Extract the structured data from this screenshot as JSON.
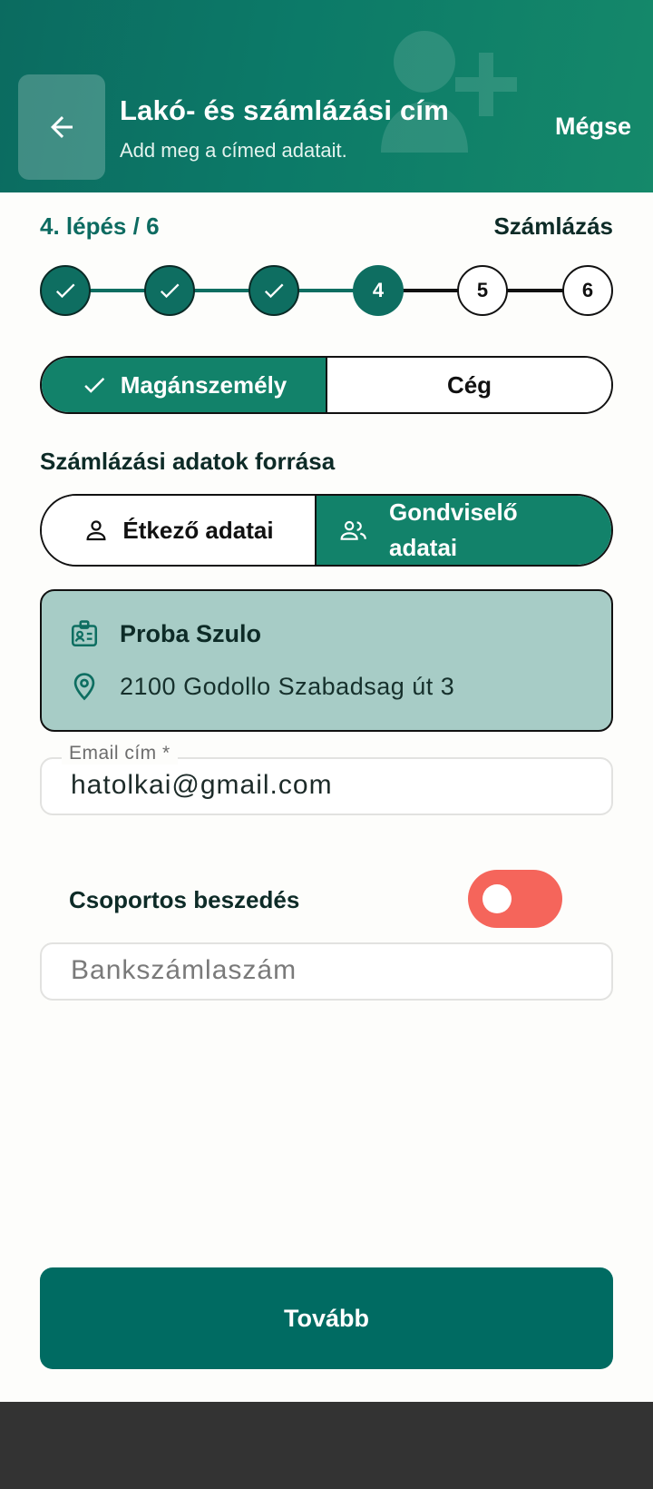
{
  "header": {
    "title": "Lakó- és számlázási cím",
    "subtitle": "Add meg a címed adatait.",
    "cancel_label": "Mégse",
    "back_icon": "arrow-left-icon",
    "bg_icon": "person-add-icon"
  },
  "steps": {
    "counter": "4. lépés / 6",
    "current_name": "Számlázás",
    "items": [
      {
        "state": "done",
        "label": ""
      },
      {
        "state": "done",
        "label": ""
      },
      {
        "state": "done",
        "label": ""
      },
      {
        "state": "active",
        "label": "4"
      },
      {
        "state": "todo",
        "label": "5"
      },
      {
        "state": "todo",
        "label": "6"
      }
    ]
  },
  "person_type": {
    "options": [
      "Magánszemély",
      "Cég"
    ],
    "selected": "Magánszemély"
  },
  "billing_source": {
    "title": "Számlázási adatok forrása",
    "options": [
      "Étkező adatai",
      "Gondviselő adatai"
    ],
    "option_line2": "adatai",
    "option_line1": "Gondviselő",
    "selected": "Gondviselő adatai"
  },
  "info_card": {
    "name": "Proba Szulo",
    "address": "2100 Godollo Szabadsag út 3"
  },
  "email": {
    "label": "Email cím *",
    "value": "hatolkai@gmail.com"
  },
  "group_billing": {
    "label": "Csoportos beszedés",
    "enabled": false
  },
  "bank_account": {
    "placeholder": "Bankszámlaszám",
    "value": ""
  },
  "next_label": "Tovább",
  "colors": {
    "primary": "#0e6e61",
    "accent": "#12826a",
    "toggle_off": "#f5655b",
    "card_bg": "#a7ccc6"
  }
}
